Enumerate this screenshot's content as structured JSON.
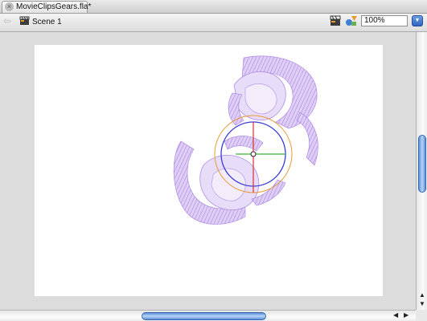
{
  "document": {
    "tab_title": "MovieClipsGears.fla*",
    "close_icon": "close-icon"
  },
  "edit_bar": {
    "scene_label": "Scene 1",
    "zoom_value": "100%",
    "back_icon": "back-arrow-icon",
    "scene_icon": "clapperboard-icon",
    "edit_scene_icon": "edit-scene-icon",
    "edit_symbol_icon": "edit-symbol-icon"
  },
  "colors": {
    "stage": "#ffffff",
    "workspace": "#dcdcdc",
    "artwork_fill": "#c9a8ee",
    "artwork_stroke": "#9c6fe0",
    "selection_circle": "#3a3ad8",
    "rotation_circle": "#e89a3a",
    "axis_vertical": "#d83030",
    "axis_horizontal": "#3fb03f"
  },
  "scrollbars": {
    "vertical_position": 0.45,
    "horizontal_position": 0.48
  }
}
